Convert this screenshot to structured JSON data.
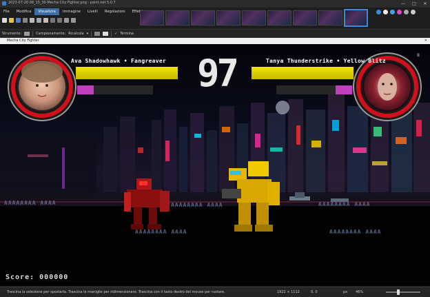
{
  "window": {
    "title": "2023-07-20 08_15_30-Mecha City Fighter.png - paint.net 5.0.7",
    "minimize": "—",
    "maximize": "□",
    "close": "✕"
  },
  "menu": {
    "items": [
      "File",
      "Modifica",
      "Visualizza",
      "Immagine",
      "Livelli",
      "Regolazioni",
      "Effetti"
    ],
    "active": "Visualizza"
  },
  "options_bar": {
    "tool_label": "Strumento:",
    "sampling_label": "Campionamento:",
    "sampling_value": "Ricalcola",
    "finish_label": "Termina"
  },
  "document": {
    "title": "Mecha City Fighter",
    "close": "✕"
  },
  "game": {
    "player1_name": "Ava Shadowhawk • Fangreaver",
    "player2_name": "Tanya Thunderstrike • Yellow Blitz",
    "timer": "97",
    "score_label": "Score:",
    "score_value": "000000",
    "pause": "II",
    "glitch_text": "AAAAAAAA AAAA",
    "player1_hp": 1.0,
    "player2_hp": 1.0,
    "player1_energy": 0.22,
    "player2_energy": 0.22
  },
  "status": {
    "message": "Trascina la selezione per spostarla. Trascina le maniglie per ridimensionare. Trascina con il tasto destro del mouse per ruotare.",
    "dimensions": "1922 × 1112",
    "selection": "0, 0",
    "unit": "px",
    "zoom": "46%"
  },
  "icons": [
    "app-icon",
    "new-icon",
    "open-icon",
    "save-icon",
    "print-icon",
    "cut-icon",
    "copy-icon",
    "paste-icon",
    "undo-icon",
    "redo-icon",
    "settings-icon",
    "help-icon"
  ],
  "colors": {
    "menu_active": "#3a6ea5",
    "hp": "#f2e300",
    "energy": "#c23fc0",
    "portrait_ring": "#d0101a"
  }
}
